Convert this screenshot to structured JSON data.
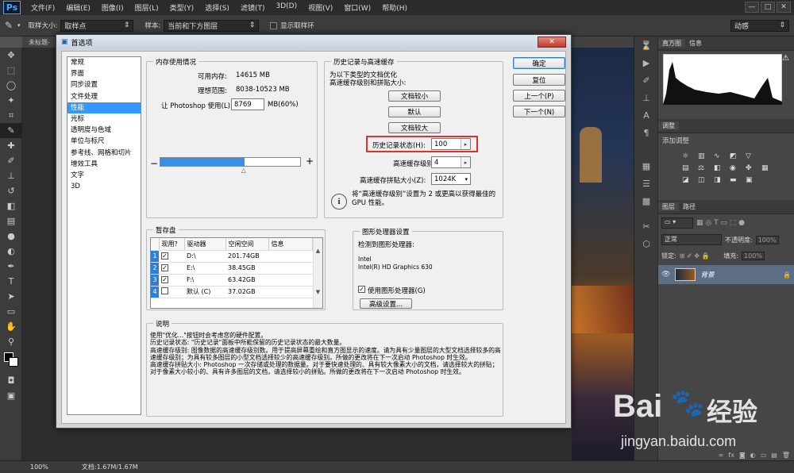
{
  "menubar": {
    "logo": "Ps",
    "items": [
      "文件(F)",
      "编辑(E)",
      "图像(I)",
      "图层(L)",
      "类型(Y)",
      "选择(S)",
      "滤镜(T)",
      "3D(D)",
      "视图(V)",
      "窗口(W)",
      "帮助(H)"
    ],
    "window_controls": [
      "—",
      "□",
      "✕"
    ]
  },
  "options": {
    "sample_size_label": "取样大小:",
    "sample_size_value": "取样点",
    "sample_label": "样本:",
    "sample_value": "当前和下方图层",
    "show_ring_label": "显示取样环",
    "workspace": "动感"
  },
  "document_tab": "未标题-",
  "status": {
    "zoom": "100%",
    "doc": "文档:1.67M/1.67M"
  },
  "panels": {
    "top_tabs": [
      "直方图",
      "信息"
    ],
    "adjust_tab": "调整",
    "add_adjust": "添加调整",
    "layers_tabs": [
      "图层",
      "路径"
    ],
    "blend_mode": "正常",
    "opacity_label": "不透明度:",
    "opacity_value": "100%",
    "lock_label": "锁定:",
    "fill_label": "填充:",
    "fill_value": "100%",
    "layer_name": "背景"
  },
  "dialog": {
    "title": "首选项",
    "close": "✕",
    "categories": [
      "常规",
      "界面",
      "同步设置",
      "文件处理",
      "性能",
      "光标",
      "透明度与色域",
      "单位与标尺",
      "参考线、网格和切片",
      "增效工具",
      "文字",
      "3D"
    ],
    "active_category": 4,
    "memory": {
      "legend": "内存使用情况",
      "available_label": "可用内存:",
      "available_value": "14615 MB",
      "ideal_label": "理想范围:",
      "ideal_value": "8038-10523 MB",
      "use_label": "让 Photoshop 使用(L):",
      "use_value": "8769",
      "use_suffix": "MB(60%)",
      "minus": "−",
      "plus": "+",
      "slider_fraction": 0.6
    },
    "history": {
      "legend": "历史记录与高速缓存",
      "desc_line1": "为以下类型的文档优化",
      "desc_line2": "高速缓存级别和拼贴大小:",
      "btn_tall_thin": "文档较小",
      "btn_default": "默认",
      "btn_big_flat": "文档较大",
      "states_label": "历史记录状态(H):",
      "states_value": "100",
      "levels_label": "高速缓存级别(C):",
      "levels_value": "4",
      "tile_label": "高速缓存拼贴大小(Z):",
      "tile_value": "1024K",
      "info_text": "将“高速缓存级别”设置为 2 或更高以获得最佳的 GPU 性能。"
    },
    "scratch": {
      "legend": "暂存盘",
      "headers": [
        "现用？",
        "驱动器",
        "空闲空间",
        "信息"
      ],
      "rows": [
        {
          "num": "1",
          "checked": true,
          "drive": "D:\\",
          "free": "201.74GB"
        },
        {
          "num": "2",
          "checked": true,
          "drive": "E:\\",
          "free": "38.45GB"
        },
        {
          "num": "3",
          "checked": true,
          "drive": "F:\\",
          "free": "63.42GB"
        },
        {
          "num": "4",
          "checked": false,
          "drive": "默认 (C)",
          "free": "37.02GB"
        }
      ]
    },
    "gpu": {
      "legend": "图形处理器设置",
      "detected_label": "检测到图形处理器:",
      "vendor": "Intel",
      "model": "Intel(R) HD Graphics 630",
      "use_gpu_label": "使用图形处理器(G)",
      "advanced": "高级设置..."
    },
    "description": {
      "legend": "说明",
      "lines": [
        "使用\"优化...\"按钮时会考虑您的硬件配置。",
        "历史记录状态: \"历史记录\"面板中所能保留的历史记录状态的最大数量。",
        "高速缓存级别: 图像数据的高速缓存级别数。用于提高屏幕重绘和直方图显示的速度。请为具有少量图层的大型文档选择较多的高速缓存级别；为具有较多图层的小型文档选择较少的高速缓存级别。所做的更改将在下一次启动 Photoshop 时生效。",
        "高速缓存拼贴大小: Photoshop 一次存储或处理的数据量。对于要快速处理的、具有较大像素大小的文档，请选择较大的拼贴；对于像素大小较小的、具有许多图层的文档，请选择较小的拼贴。所做的更改将在下一次启动 Photoshop 时生效。"
      ]
    },
    "buttons": {
      "ok": "确定",
      "reset": "复位",
      "prev": "上一个(P)",
      "next": "下一个(N)"
    }
  },
  "watermark": {
    "brand": "Bai",
    "brand2": "经验",
    "url": "jingyan.baidu.com"
  },
  "colors": {
    "accent": "#3399ff",
    "highlight": "#e0302a"
  }
}
